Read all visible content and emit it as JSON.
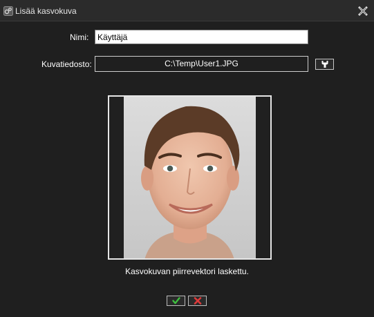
{
  "window": {
    "title": "Lisää kasvokuva",
    "close_icon": "close-icon"
  },
  "form": {
    "name_label": "Nimi:",
    "name_value": "Käyttäjä",
    "file_label": "Kuvatiedosto:",
    "file_value": "C:\\Temp\\User1.JPG",
    "browse_icon": "wrench-icon"
  },
  "photo": {
    "subject": "face-photo"
  },
  "status": "Kasvokuvan piirrevektori laskettu.",
  "buttons": {
    "ok_icon": "checkmark-icon",
    "cancel_icon": "x-icon"
  },
  "colors": {
    "background": "#1f1f1f",
    "titlebar": "#2b2b2b",
    "ok_green": "#3fbf3f",
    "cancel_red": "#e03a3a"
  }
}
